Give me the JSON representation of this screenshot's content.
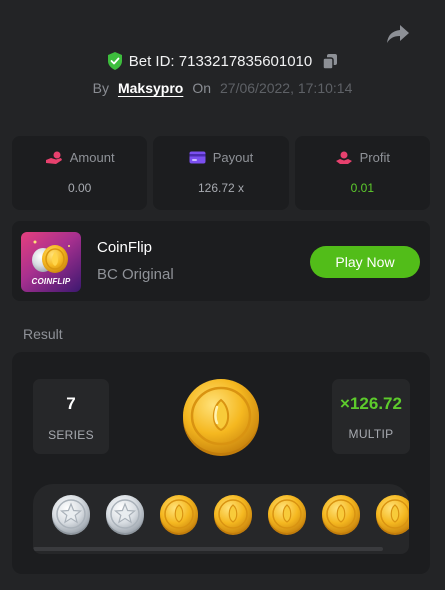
{
  "header": {
    "bet_id_label": "Bet ID: 7133217835601010",
    "by_label": "By",
    "username": "Maksypro",
    "on_label": "On",
    "date": "27/06/2022, 17:10:14"
  },
  "stats": [
    {
      "label": "Amount",
      "value": "0.00",
      "icon": "hand-coin-icon",
      "color": "#e8416e"
    },
    {
      "label": "Payout",
      "value": "126.72 x",
      "icon": "card-icon",
      "color": "#7b4ff0"
    },
    {
      "label": "Profit",
      "value": "0.01",
      "icon": "hand-money-icon",
      "color": "#e8416e",
      "value_color": "#5dcb2c"
    }
  ],
  "game": {
    "title": "CoinFlip",
    "subtitle": "BC Original",
    "thumbnail_label": "COINFLIP",
    "play_label": "Play Now"
  },
  "result": {
    "section_label": "Result",
    "series_value": "7",
    "series_label": "SERIES",
    "multiplier_value": "×126.72",
    "multiplier_label": "MULTIP",
    "coins": [
      "silver",
      "silver",
      "gold",
      "gold",
      "gold",
      "gold",
      "gold"
    ]
  },
  "colors": {
    "background": "#232426",
    "card": "#1c1d1f",
    "accent_green": "#52bd19",
    "profit_green": "#5dcb2c",
    "gold": "#f5b820",
    "silver": "#d8dde2"
  }
}
